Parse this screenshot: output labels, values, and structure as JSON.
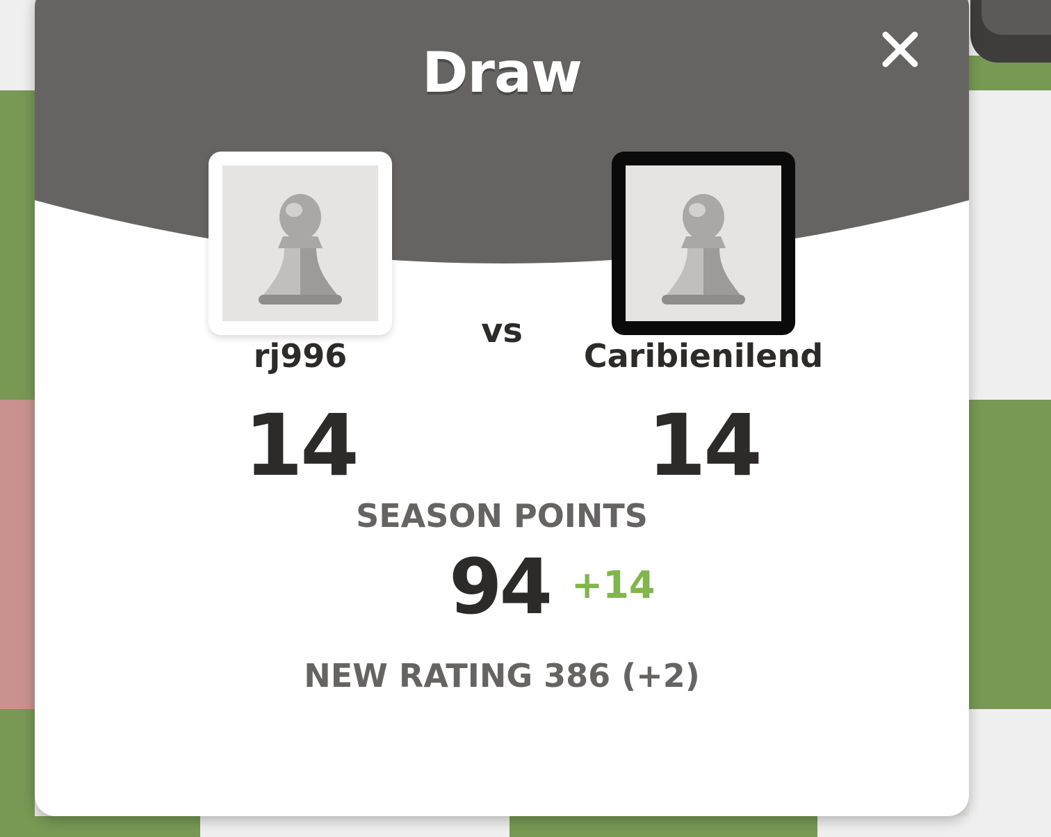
{
  "result": {
    "title": "Draw"
  },
  "players": {
    "left": {
      "name": "rj996",
      "score": "14"
    },
    "vs_label": "vs",
    "right": {
      "name": "Caribienilend",
      "score": "14"
    }
  },
  "season": {
    "label": "SEASON POINTS",
    "value": "94",
    "delta": "+14"
  },
  "rating": {
    "text": "NEW RATING 386 (+2)"
  },
  "icons": {
    "close": "close-icon",
    "avatar": "pawn-icon"
  },
  "colors": {
    "header": "#666463",
    "accent_green": "#81b64c",
    "board_green": "#779954",
    "board_light": "#ebecd0",
    "highlight_pink": "#c9928f"
  }
}
